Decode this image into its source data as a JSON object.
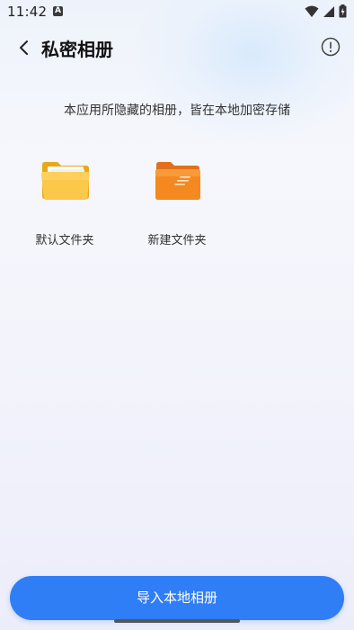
{
  "status_bar": {
    "time": "11:42",
    "notification_glyph": "A"
  },
  "header": {
    "title": "私密相册"
  },
  "notice": "本应用所隐藏的相册，皆在本地加密存储",
  "folders": [
    {
      "label": "默认文件夹",
      "icon": "folder-icon",
      "color": "#f9c23c"
    },
    {
      "label": "新建文件夹",
      "icon": "new-folder-icon",
      "color": "#f58a1f"
    }
  ],
  "bottom": {
    "import_label": "导入本地相册",
    "button_color": "#2f7ef6"
  }
}
